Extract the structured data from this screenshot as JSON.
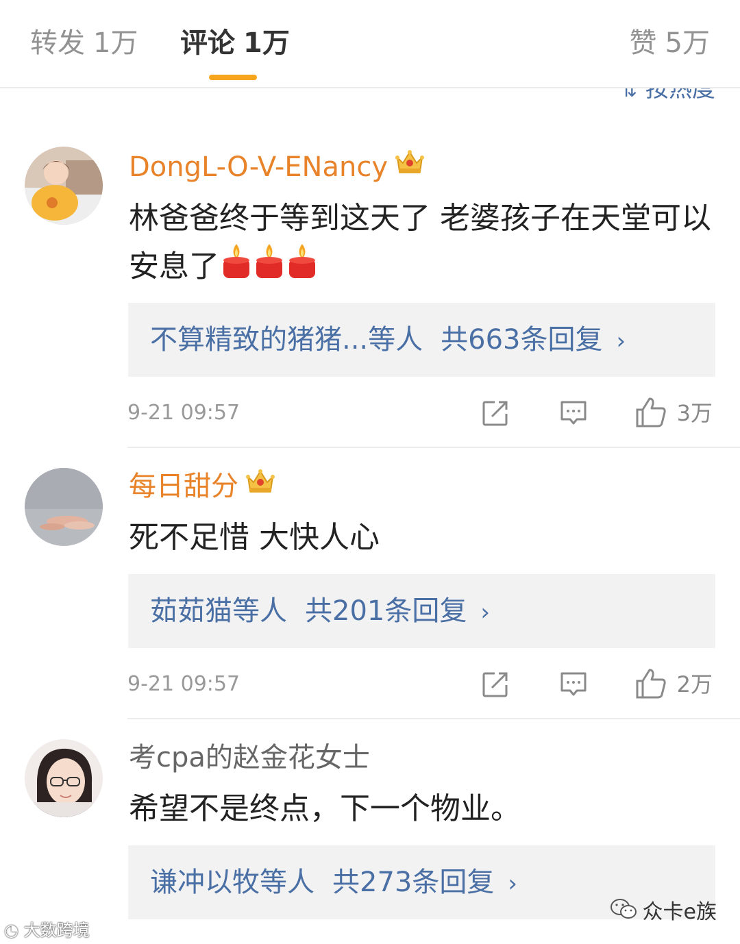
{
  "tabs": {
    "repost": {
      "label": "转发",
      "count": "1万"
    },
    "comment": {
      "label": "评论",
      "count": "1万"
    },
    "like": {
      "label": "赞",
      "count": "5万"
    }
  },
  "sort": {
    "label": "按热度",
    "icon": "sort-icon"
  },
  "colors": {
    "accent": "#f7a51c",
    "vip_name": "#e8832a",
    "link": "#4a6fa5",
    "reply_bg": "#f2f2f2"
  },
  "comments": [
    {
      "username": "DongL-O-V-ENancy",
      "vip": true,
      "text": "林爸爸终于等到这天了 老婆孩子在天堂可以安息了",
      "emoji": "candle-emoji",
      "reply_preview": "不算精致的猪猪...等人",
      "reply_total": "共663条回复",
      "time": "9-21 09:57",
      "likes": "3万"
    },
    {
      "username": "每日甜分",
      "vip": true,
      "text": "死不足惜 大快人心",
      "reply_preview": "茹茹猫等人",
      "reply_total": "共201条回复",
      "time": "9-21 09:57",
      "likes": "2万"
    },
    {
      "username": "考cpa的赵金花女士",
      "vip": false,
      "text": "希望不是终点，下一个物业。",
      "reply_preview": "谦冲以牧等人",
      "reply_total": "共273条回复"
    }
  ],
  "watermarks": {
    "left": "大数跨境",
    "right": "众卡e族"
  }
}
